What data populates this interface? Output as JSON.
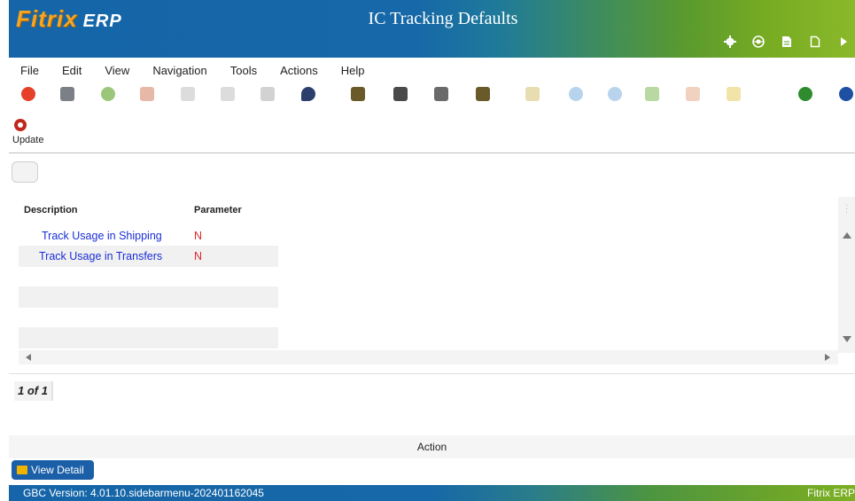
{
  "header": {
    "logo_main": "Fitrix",
    "logo_suffix": "ERP",
    "title": "IC Tracking Defaults",
    "icons": [
      "gear-icon",
      "globe-icon",
      "document-icon",
      "new-page-icon",
      "play-icon"
    ]
  },
  "menu": {
    "items": [
      {
        "label": "File"
      },
      {
        "label": "Edit"
      },
      {
        "label": "View"
      },
      {
        "label": "Navigation"
      },
      {
        "label": "Tools"
      },
      {
        "label": "Actions"
      },
      {
        "label": "Help"
      }
    ]
  },
  "toolbar": {
    "update_label": "Update"
  },
  "table": {
    "headers": {
      "description": "Description",
      "parameter": "Parameter"
    },
    "rows": [
      {
        "description": "Track Usage in Shipping",
        "parameter": "N"
      },
      {
        "description": "Track Usage in Transfers",
        "parameter": "N"
      }
    ]
  },
  "pager": {
    "label": "1 of 1"
  },
  "action_bar": {
    "label": "Action"
  },
  "view_detail": {
    "label": "View Detail"
  },
  "status_bar": {
    "version": "GBC Version: 4.01.10.sidebarmenu-202401162045",
    "brand": "Fitrix ERP"
  },
  "colors": {
    "header_blue": "#1565a8",
    "header_green": "#8ab82a",
    "logo_orange": "#f5a623",
    "link_blue": "#1a2ed6",
    "param_red": "#e0262a",
    "button_blue": "#1a5fa8"
  }
}
